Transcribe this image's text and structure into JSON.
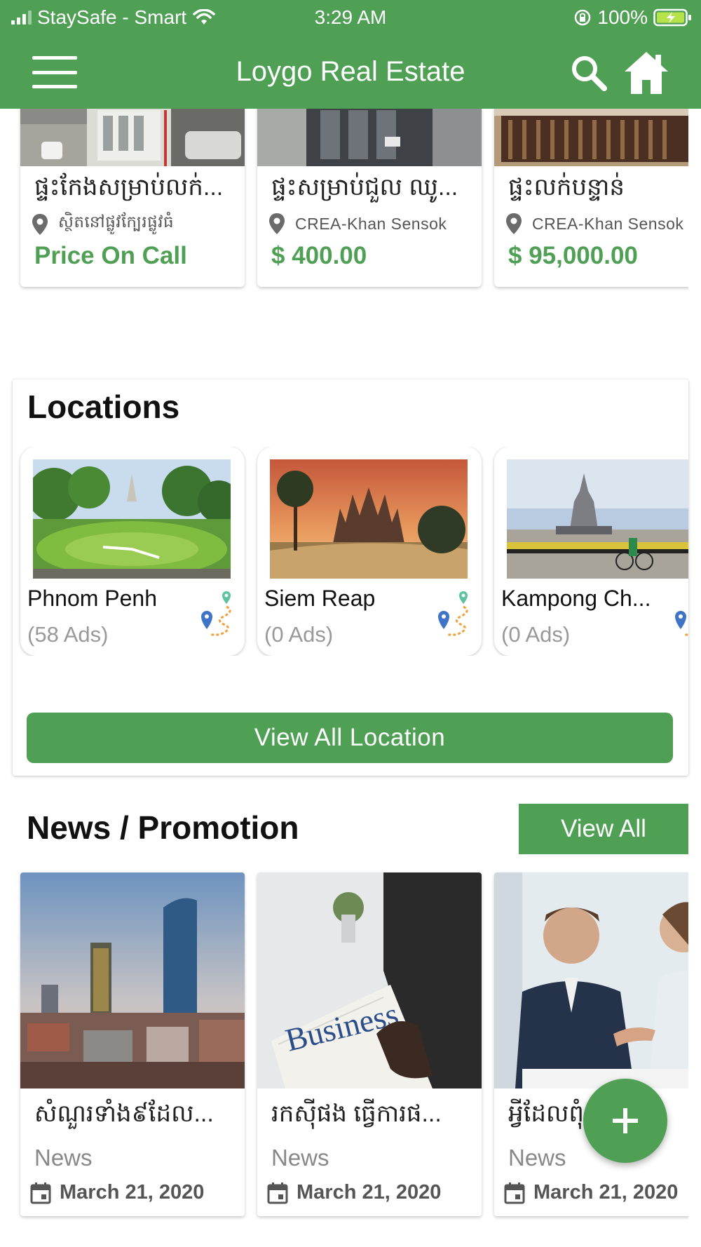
{
  "status_bar": {
    "carrier": "StaySafe - Smart",
    "time": "3:29 AM",
    "battery": "100%"
  },
  "header": {
    "title": "Loygo Real Estate",
    "icons": [
      "menu-icon",
      "search-icon",
      "home-icon"
    ]
  },
  "properties": [
    {
      "title": "ផ្ទះកែងសម្រាប់លក់...",
      "location": "ស្ថិតនៅផ្លូវក្បែរផ្លូវធំ",
      "price": "Price On Call"
    },
    {
      "title": "ផ្ទះសម្រាប់ជួល ឈូ...",
      "location": "CREA-Khan Sensok",
      "price": "$ 400.00"
    },
    {
      "title": "ផ្ទះលក់បន្ទាន់",
      "location": "CREA-Khan Sensok",
      "price": "$ 95,000.00"
    }
  ],
  "locations": {
    "heading": "Locations",
    "items": [
      {
        "name": "Phnom Penh",
        "ads": "(58 Ads)"
      },
      {
        "name": "Siem Reap",
        "ads": "(0 Ads)"
      },
      {
        "name": "Kampong Ch...",
        "ads": "(0 Ads)"
      }
    ],
    "view_all": "View All Location"
  },
  "news": {
    "heading": "News / Promotion",
    "view_all": "View All",
    "items": [
      {
        "title": "សំណួរទាំង៩ដែល...",
        "category": "News",
        "date": "March 21, 2020"
      },
      {
        "title": "រកស៊ីផង ធ្វើការផ...",
        "category": "News",
        "date": "March 21, 2020"
      },
      {
        "title": "អ្វីដែលពុំ...",
        "category": "News",
        "date": "March 21, 2020"
      }
    ]
  },
  "fab": {
    "label": "+"
  },
  "colors": {
    "brand": "#4fa055",
    "price": "#4fa055",
    "muted": "#999999"
  }
}
